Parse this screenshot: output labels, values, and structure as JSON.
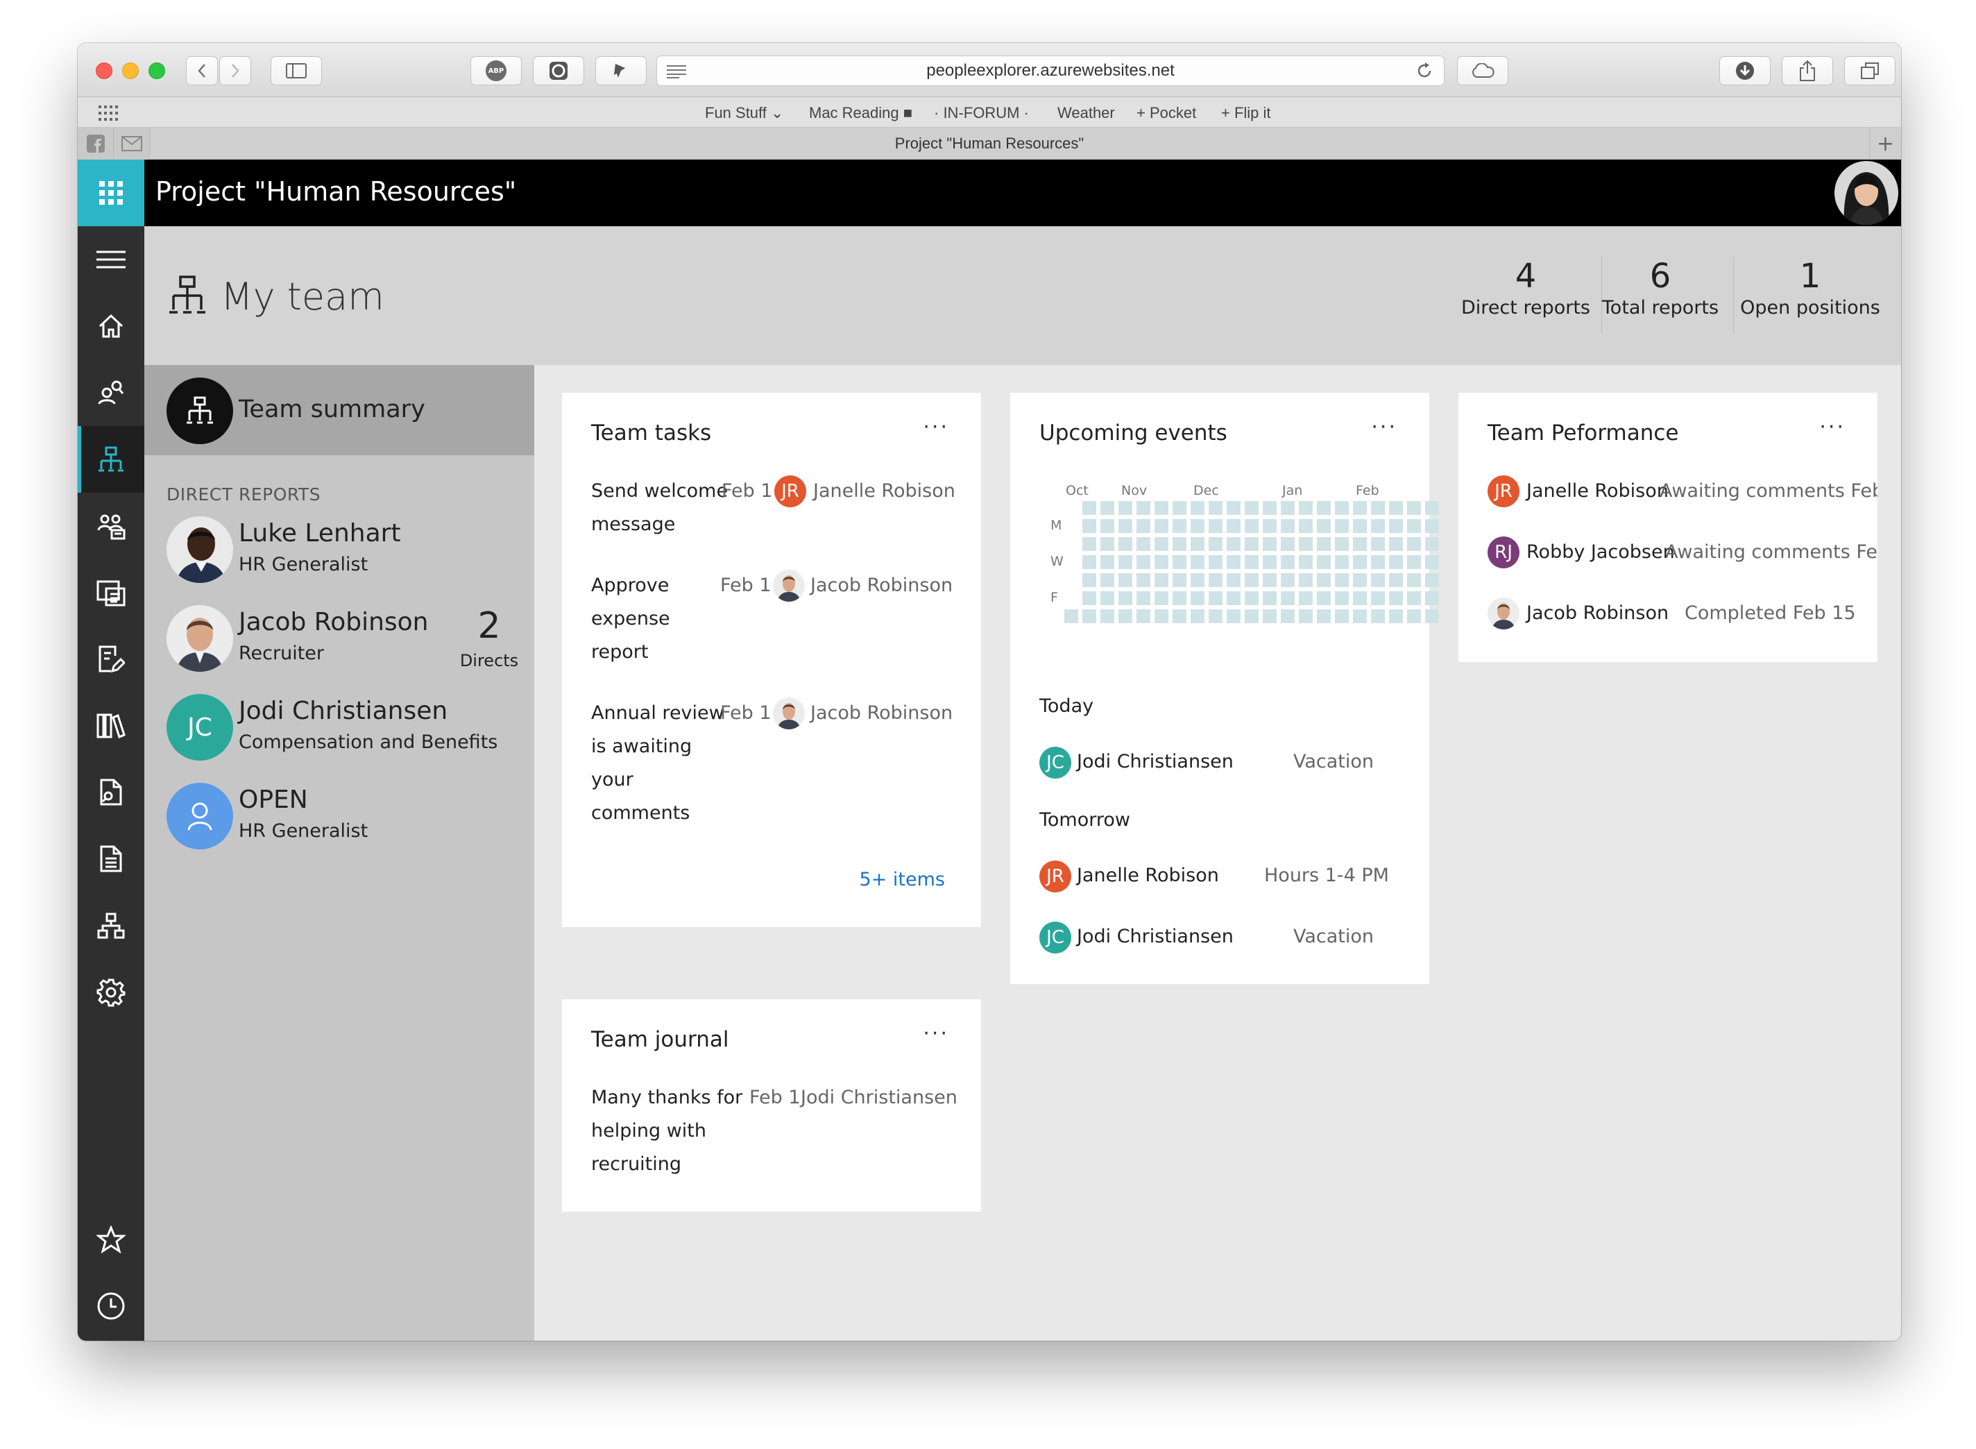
{
  "browser": {
    "url": "peopleexplorer.azurewebsites.net",
    "abp_label": "ABP",
    "bookmarks": [
      "Fun Stuff ⌄",
      "Mac Reading ■",
      "· IN-FORUM ·",
      "Weather",
      "+ Pocket",
      "+ Flip it"
    ],
    "tab_title": "Project \"Human Resources\"",
    "tab_add": "+"
  },
  "app": {
    "title": "Project \"Human Resources\""
  },
  "page": {
    "title": "My team",
    "stats": [
      {
        "value": "4",
        "label": "Direct reports"
      },
      {
        "value": "6",
        "label": "Total reports"
      },
      {
        "value": "1",
        "label": "Open positions"
      }
    ]
  },
  "team": {
    "summary_label": "Team summary",
    "direct_reports_heading": "DIRECT REPORTS",
    "people": [
      {
        "name": "Luke Lenhart",
        "role": "HR Generalist"
      },
      {
        "name": "Jacob Robinson",
        "role": "Recruiter",
        "directs_count": "2",
        "directs_label": "Directs"
      },
      {
        "name": "Jodi Christiansen",
        "role": "Compensation and Benefits",
        "initials": "JC"
      },
      {
        "name": "OPEN",
        "role": "HR Generalist"
      }
    ]
  },
  "cards": {
    "more": "···",
    "tasks": {
      "title": "Team tasks",
      "items": [
        {
          "lines": [
            "Send welcome",
            "message"
          ],
          "date": "Feb 1",
          "initials": "JR",
          "person": "Janelle Robison"
        },
        {
          "lines": [
            "Approve",
            "expense",
            "report"
          ],
          "date": "Feb 1",
          "person": "Jacob Robinson"
        },
        {
          "lines": [
            "Annual review",
            "is awaiting",
            "your",
            "comments"
          ],
          "date": "Feb 1",
          "person": "Jacob Robinson"
        }
      ],
      "more_link": "5+ items"
    },
    "journal": {
      "title": "Team journal",
      "lines": [
        "Many thanks for",
        "helping with",
        "recruiting"
      ],
      "date": "Feb 1",
      "person": "Jodi Christiansen"
    },
    "events": {
      "title": "Upcoming events",
      "months": [
        "Oct",
        "Nov",
        "Dec",
        "Jan",
        "Feb"
      ],
      "days": [
        "M",
        "W",
        "F"
      ],
      "today_label": "Today",
      "tomorrow_label": "Tomorrow",
      "today": [
        {
          "initials": "JC",
          "person": "Jodi Christiansen",
          "detail": "Vacation"
        }
      ],
      "tomorrow": [
        {
          "initials": "JR",
          "person": "Janelle Robison",
          "detail": "Hours 1-4 PM"
        },
        {
          "initials": "JC",
          "person": "Jodi Christiansen",
          "detail": "Vacation"
        }
      ]
    },
    "performance": {
      "title": "Team Peformance",
      "items": [
        {
          "initials": "JR",
          "person": "Janelle Robison",
          "status": "Awaiting comments Feb"
        },
        {
          "initials": "RJ",
          "person": "Robby Jacobsen",
          "status": "Awaiting comments Feb"
        },
        {
          "person": "Jacob Robinson",
          "status": "Completed Feb 15"
        }
      ]
    }
  },
  "colors": {
    "accent": "#2bb5c6",
    "jr_avatar": "#e2572e",
    "jc_avatar": "#2aa99b",
    "rj_avatar": "#7a3b78",
    "open_avatar": "#5b9be8",
    "link": "#1a73c8",
    "heatmap_cell": "#cfe3e6"
  },
  "icons": [
    "grid-icon",
    "hamburger-icon",
    "home-icon",
    "people-search-icon",
    "org-chart-icon",
    "group-icon",
    "reports-icon",
    "edit-document-icon",
    "library-icon",
    "document-search-icon",
    "list-document-icon",
    "hierarchy-icon",
    "settings-icon",
    "star-icon",
    "clock-icon"
  ]
}
